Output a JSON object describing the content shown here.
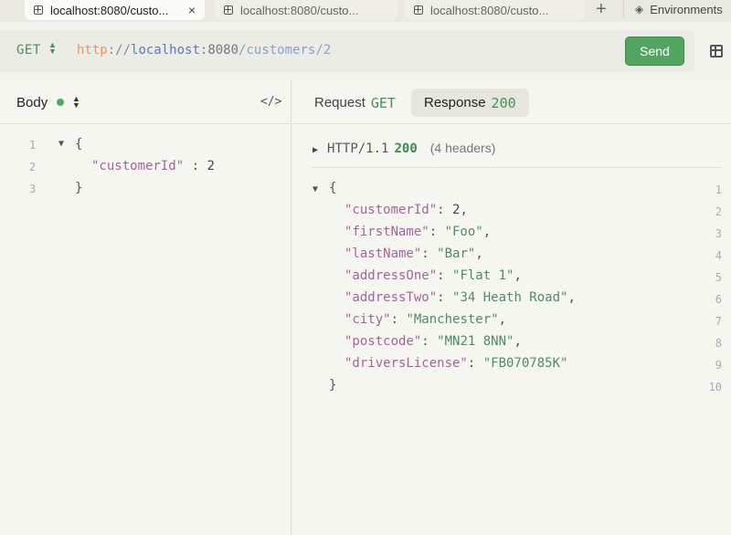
{
  "tabs": [
    {
      "label": "localhost:8080/custo...",
      "active": true,
      "close": "×"
    },
    {
      "label": "localhost:8080/custo...",
      "active": false
    },
    {
      "label": "localhost:8080/custo...",
      "active": false
    }
  ],
  "tabbar": {
    "add": "+",
    "environments": "Environments"
  },
  "request": {
    "method": "GET",
    "url": {
      "scheme": "http",
      "sep": "://",
      "host": "localhost",
      "colon": ":",
      "port": "8080",
      "path": "/customers/2"
    },
    "send_label": "Send"
  },
  "body_panel": {
    "label": "Body",
    "code_icon": "</>",
    "lines": [
      {
        "n": "1",
        "text": "{"
      },
      {
        "n": "2",
        "key": "\"customerId\"",
        "sep": " : ",
        "value": "2"
      },
      {
        "n": "3",
        "text": "}"
      }
    ]
  },
  "response_panel": {
    "tab_request": {
      "label": "Request",
      "method": "GET"
    },
    "tab_response": {
      "label": "Response",
      "code": "200"
    },
    "status": {
      "protocol": "HTTP/1.1",
      "code": "200",
      "headers": "(4 headers)"
    },
    "lines": [
      {
        "n": "1",
        "text": "{"
      },
      {
        "n": "2",
        "key": "\"customerId\"",
        "value": "2",
        "type": "num"
      },
      {
        "n": "3",
        "key": "\"firstName\"",
        "value": "\"Foo\"",
        "type": "str"
      },
      {
        "n": "4",
        "key": "\"lastName\"",
        "value": "\"Bar\"",
        "type": "str"
      },
      {
        "n": "5",
        "key": "\"addressOne\"",
        "value": "\"Flat 1\"",
        "type": "str"
      },
      {
        "n": "6",
        "key": "\"addressTwo\"",
        "value": "\"34 Heath Road\"",
        "type": "str"
      },
      {
        "n": "7",
        "key": "\"city\"",
        "value": "\"Manchester\"",
        "type": "str"
      },
      {
        "n": "8",
        "key": "\"postcode\"",
        "value": "\"MN21 8NN\"",
        "type": "str"
      },
      {
        "n": "9",
        "key": "\"driversLicense\"",
        "value": "\"FB070785K\"",
        "type": "str",
        "last": true
      },
      {
        "n": "10",
        "text": "}"
      }
    ]
  },
  "colors": {
    "accent": "#51a561",
    "key": "#a0649a",
    "string": "#4f8a66"
  }
}
